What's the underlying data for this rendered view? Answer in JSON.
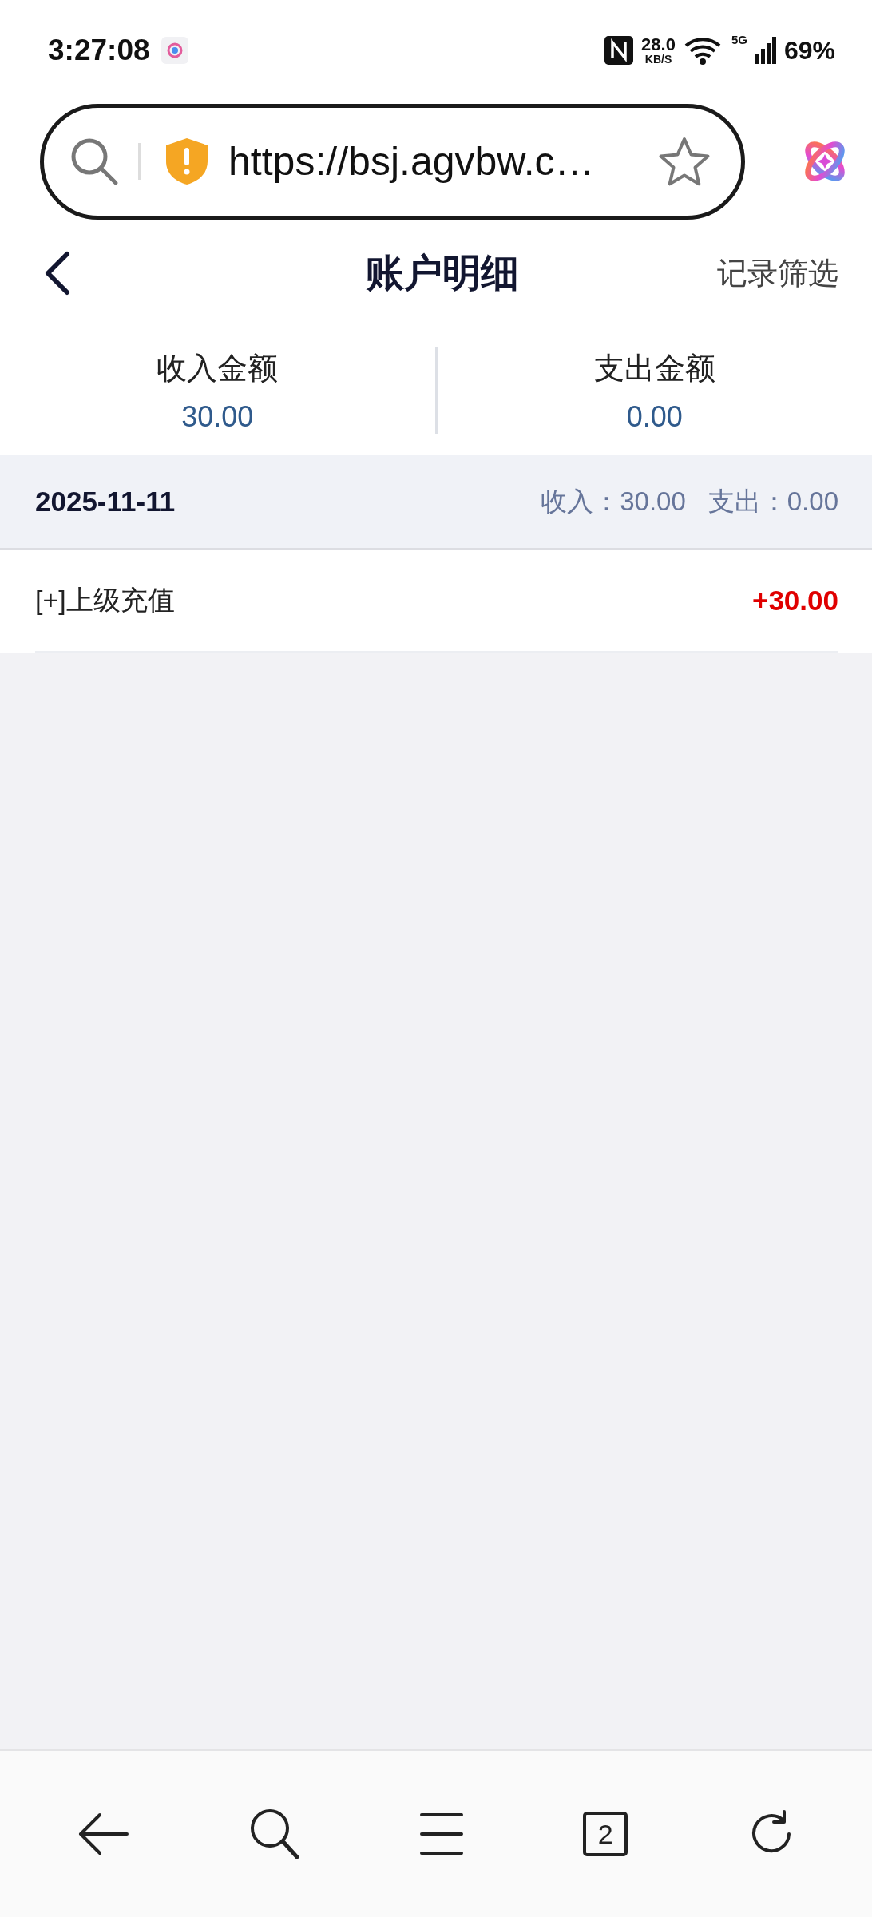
{
  "status_bar": {
    "time": "3:27:08",
    "speed": "28.0",
    "speed_unit": "KB/S",
    "network": "5G",
    "battery": "69%"
  },
  "address_bar": {
    "url": "https://bsj.agvbw.c…"
  },
  "header": {
    "title": "账户明细",
    "action": "记录筛选"
  },
  "summary": [
    {
      "label": "收入金额",
      "value": "30.00"
    },
    {
      "label": "支出金额",
      "value": "0.00"
    }
  ],
  "groups": [
    {
      "date": "2025-11-11",
      "income": "收入：30.00",
      "expense": "支出：0.00",
      "records": [
        {
          "label": "[+]上级充值",
          "amount": "+30.00",
          "kind": "income"
        }
      ]
    }
  ],
  "bottom_nav": {
    "tab_count": "2"
  }
}
